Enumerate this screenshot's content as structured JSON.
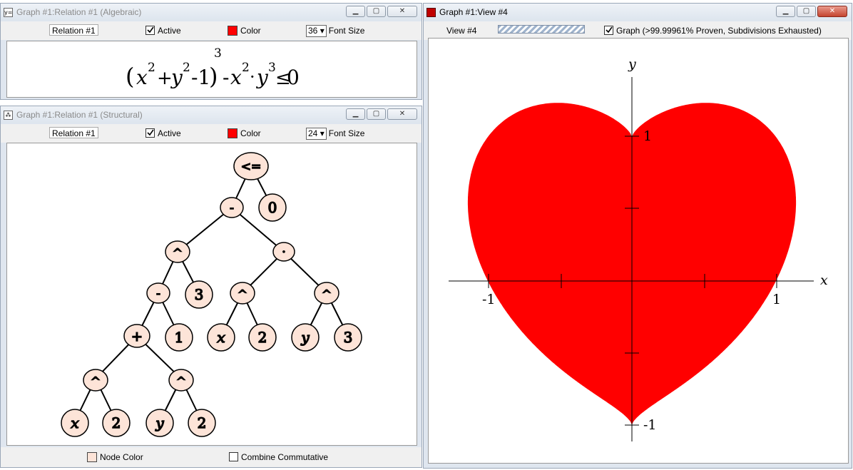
{
  "algebraic": {
    "title": "Graph #1:Relation #1 (Algebraic)",
    "relation_name": "Relation #1",
    "active_label": "Active",
    "active_checked": true,
    "color_label": "Color",
    "color_value": "#ff0000",
    "font_size": "36",
    "font_size_label": "Font Size",
    "formula": {
      "open": "(",
      "x": "x",
      "x_exp": "2",
      "plus": "+",
      "y": "y",
      "y_exp": "2",
      "minus_one": "-1",
      "close": ")",
      "outer_exp": "3",
      "minus": "-",
      "x2": "x",
      "x2_exp": "2",
      "dot": "·",
      "y2": "y",
      "y2_exp": "3",
      "leq": "≤",
      "zero": "0"
    }
  },
  "structural": {
    "title": "Graph #1:Relation #1 (Structural)",
    "relation_name": "Relation #1",
    "active_label": "Active",
    "active_checked": true,
    "color_label": "Color",
    "color_value": "#ff0000",
    "font_size": "24",
    "font_size_label": "Font Size",
    "node_fill": "#fde4d8",
    "node_color_label": "Node Color",
    "combine_label": "Combine Commutative",
    "combine_checked": false,
    "nodes": {
      "leq": "<=",
      "minus_top": "-",
      "zero": "0",
      "pow_a": "^",
      "dot": "·",
      "minus_mid": "-",
      "three_a": "3",
      "pow_x": "^",
      "pow_y": "^",
      "plus": "+",
      "one": "1",
      "x_a": "x",
      "two_a": "2",
      "y_a": "y",
      "three_b": "3",
      "pow_x2": "^",
      "pow_y2": "^",
      "x_b": "x",
      "two_b": "2",
      "y_b": "y",
      "two_c": "2"
    }
  },
  "view": {
    "title": "Graph #1:View #4",
    "view_name": "View #4",
    "graph_status": "Graph (>99.99961% Proven, Subdivisions Exhausted)",
    "graph_checked": true,
    "fill_color": "#ff0000",
    "axis": {
      "x_label": "x",
      "y_label": "y",
      "x_min_label": "-1",
      "x_max_label": "1",
      "y_max_label": "1",
      "y_min_label": "-1"
    }
  }
}
